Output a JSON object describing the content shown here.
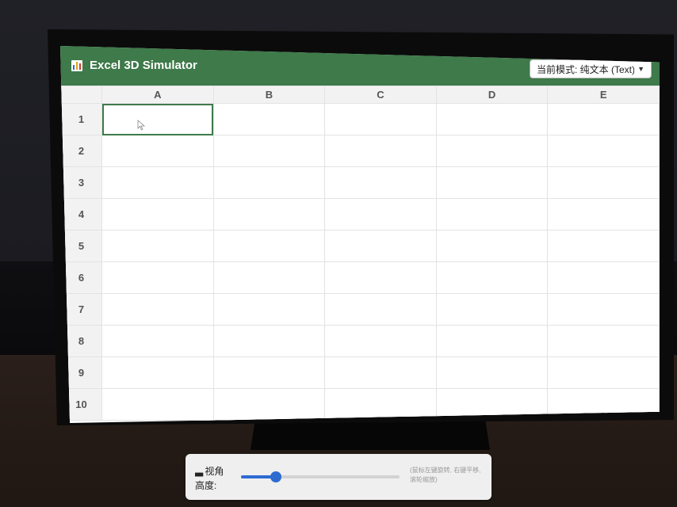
{
  "app": {
    "title": "Excel 3D Simulator",
    "accent_color": "#3e7a4a",
    "logo_icon": "bar-chart-icon"
  },
  "mode_select": {
    "value": "当前模式: 纯文本 (Text)",
    "icon": "chevron-down-icon"
  },
  "sheet": {
    "columns": [
      "A",
      "B",
      "C",
      "D",
      "E"
    ],
    "rows": [
      "1",
      "2",
      "3",
      "4",
      "5",
      "6",
      "7",
      "8",
      "9",
      "10"
    ],
    "selected_cell": "A1",
    "cells": {}
  },
  "controls": {
    "camera_label": "视角高度:",
    "camera_icon": "camera-icon",
    "slider_value": 0.22,
    "hint": "(鼠标左键旋转, 右键平移, 滚轮缩放)",
    "slider_color": "#2d6bd1"
  }
}
